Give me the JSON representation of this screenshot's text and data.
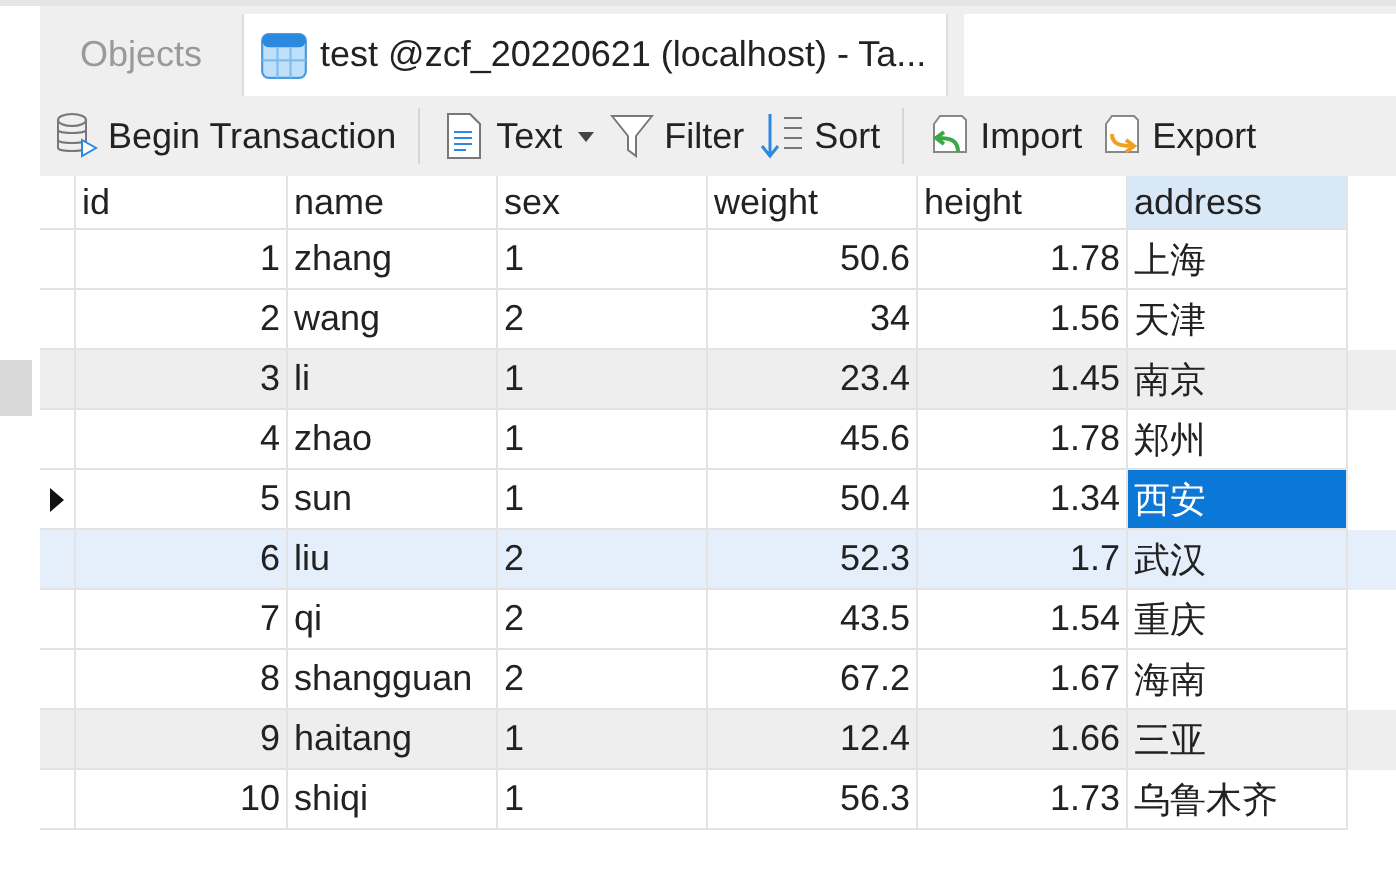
{
  "tabs": [
    {
      "label": "Objects",
      "kind": "plain",
      "selected": false
    },
    {
      "label": "test @zcf_20220621 (localhost) - Ta...",
      "kind": "table",
      "selected": true
    }
  ],
  "toolbar": [
    {
      "label": "Begin Transaction",
      "dropdown": false
    },
    {
      "label": "Text",
      "dropdown": true
    },
    {
      "label": "Filter",
      "dropdown": false
    },
    {
      "label": "Sort",
      "dropdown": false
    },
    {
      "label": "Import",
      "dropdown": false
    },
    {
      "label": "Export",
      "dropdown": false
    }
  ],
  "table": {
    "columns": [
      {
        "label": "id",
        "selected": false
      },
      {
        "label": "name",
        "selected": false
      },
      {
        "label": "sex",
        "selected": false
      },
      {
        "label": "weight",
        "selected": false
      },
      {
        "label": "height",
        "selected": false
      },
      {
        "label": "address",
        "selected": true
      }
    ],
    "rows": [
      {
        "shaded": false,
        "hovered": false,
        "current": false,
        "cells": [
          {
            "text": "1",
            "selected": false
          },
          {
            "text": "zhang",
            "selected": false
          },
          {
            "text": "1",
            "selected": false
          },
          {
            "text": "50.6",
            "selected": false
          },
          {
            "text": "1.78",
            "selected": false
          },
          {
            "text": "上海",
            "selected": false
          }
        ]
      },
      {
        "shaded": false,
        "hovered": false,
        "current": false,
        "cells": [
          {
            "text": "2",
            "selected": false
          },
          {
            "text": "wang",
            "selected": false
          },
          {
            "text": "2",
            "selected": false
          },
          {
            "text": "34",
            "selected": false
          },
          {
            "text": "1.56",
            "selected": false
          },
          {
            "text": "天津",
            "selected": false
          }
        ]
      },
      {
        "shaded": true,
        "hovered": false,
        "current": false,
        "cells": [
          {
            "text": "3",
            "selected": false
          },
          {
            "text": "li",
            "selected": false
          },
          {
            "text": "1",
            "selected": false
          },
          {
            "text": "23.4",
            "selected": false
          },
          {
            "text": "1.45",
            "selected": false
          },
          {
            "text": "南京",
            "selected": false
          }
        ]
      },
      {
        "shaded": false,
        "hovered": false,
        "current": false,
        "cells": [
          {
            "text": "4",
            "selected": false
          },
          {
            "text": "zhao",
            "selected": false
          },
          {
            "text": "1",
            "selected": false
          },
          {
            "text": "45.6",
            "selected": false
          },
          {
            "text": "1.78",
            "selected": false
          },
          {
            "text": "郑州",
            "selected": false
          }
        ]
      },
      {
        "shaded": false,
        "hovered": false,
        "current": true,
        "cells": [
          {
            "text": "5",
            "selected": false
          },
          {
            "text": "sun",
            "selected": false
          },
          {
            "text": "1",
            "selected": false
          },
          {
            "text": "50.4",
            "selected": false
          },
          {
            "text": "1.34",
            "selected": false
          },
          {
            "text": "西安",
            "selected": true
          }
        ]
      },
      {
        "shaded": false,
        "hovered": true,
        "current": false,
        "cells": [
          {
            "text": "6",
            "selected": false
          },
          {
            "text": "liu",
            "selected": false
          },
          {
            "text": "2",
            "selected": false
          },
          {
            "text": "52.3",
            "selected": false
          },
          {
            "text": "1.7",
            "selected": false
          },
          {
            "text": "武汉",
            "selected": false
          }
        ]
      },
      {
        "shaded": false,
        "hovered": false,
        "current": false,
        "cells": [
          {
            "text": "7",
            "selected": false
          },
          {
            "text": "qi",
            "selected": false
          },
          {
            "text": "2",
            "selected": false
          },
          {
            "text": "43.5",
            "selected": false
          },
          {
            "text": "1.54",
            "selected": false
          },
          {
            "text": "重庆",
            "selected": false
          }
        ]
      },
      {
        "shaded": false,
        "hovered": false,
        "current": false,
        "cells": [
          {
            "text": "8",
            "selected": false
          },
          {
            "text": "shangguan",
            "selected": false
          },
          {
            "text": "2",
            "selected": false
          },
          {
            "text": "67.2",
            "selected": false
          },
          {
            "text": "1.67",
            "selected": false
          },
          {
            "text": "海南",
            "selected": false
          }
        ]
      },
      {
        "shaded": true,
        "hovered": false,
        "current": false,
        "cells": [
          {
            "text": "9",
            "selected": false
          },
          {
            "text": "haitang",
            "selected": false
          },
          {
            "text": "1",
            "selected": false
          },
          {
            "text": "12.4",
            "selected": false
          },
          {
            "text": "1.66",
            "selected": false
          },
          {
            "text": "三亚",
            "selected": false
          }
        ]
      },
      {
        "shaded": false,
        "hovered": false,
        "current": false,
        "cells": [
          {
            "text": "10",
            "selected": false
          },
          {
            "text": "shiqi",
            "selected": false
          },
          {
            "text": "1",
            "selected": false
          },
          {
            "text": "56.3",
            "selected": false
          },
          {
            "text": "1.73",
            "selected": false
          },
          {
            "text": "乌鲁木齐",
            "selected": false
          }
        ]
      }
    ]
  }
}
